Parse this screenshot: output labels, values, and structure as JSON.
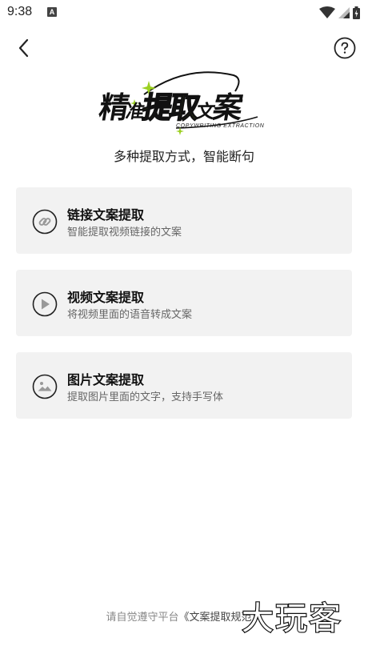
{
  "status_bar": {
    "time": "9:38",
    "notification_badge": "A"
  },
  "header": {
    "back_icon": "chevron-left-icon",
    "help_icon": "question-circle-icon"
  },
  "logo": {
    "chars": [
      "精",
      "准",
      "提",
      "取",
      "文",
      "案"
    ],
    "sub": "COPYWRITING EXTRACTION"
  },
  "tagline": "多种提取方式，智能断句",
  "cards": [
    {
      "title": "链接文案提取",
      "desc": "智能提取视频链接的文案",
      "icon": "link-icon"
    },
    {
      "title": "视频文案提取",
      "desc": "将视频里面的语音转成文案",
      "icon": "play-icon"
    },
    {
      "title": "图片文案提取",
      "desc": "提取图片里面的文字，支持手写体",
      "icon": "image-icon"
    }
  ],
  "agreement": {
    "prefix": "请自觉遵守平台",
    "link": "《文案提取规范》"
  },
  "watermark": "大玩客",
  "colors": {
    "accent_green": "#9bd021",
    "card_bg": "#f2f2f2"
  }
}
